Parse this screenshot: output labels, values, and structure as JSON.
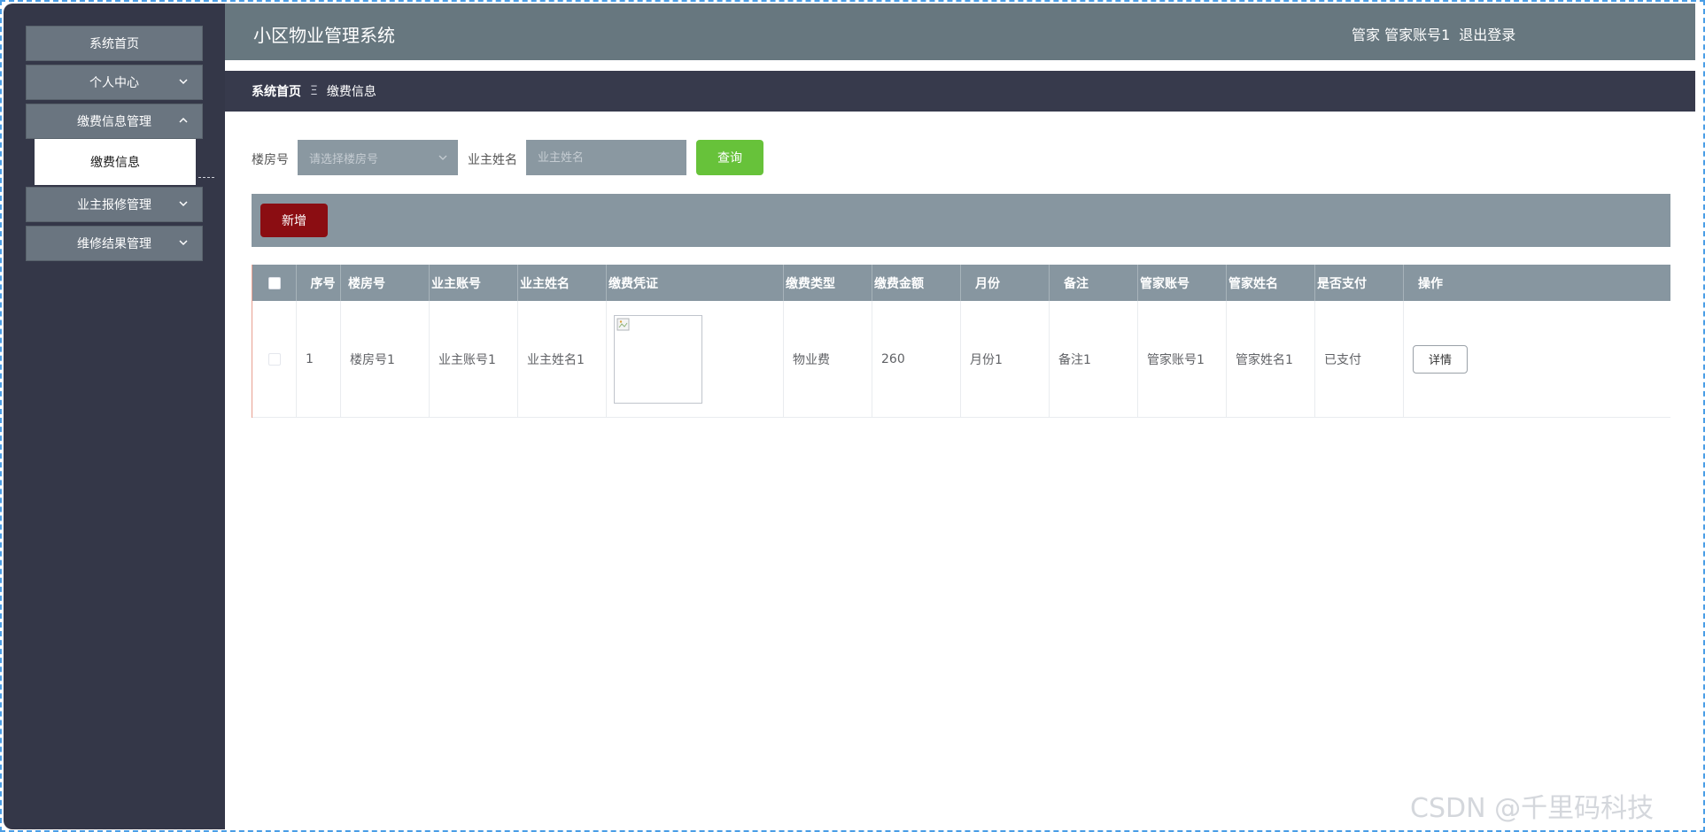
{
  "app": {
    "title": "小区物业管理系统",
    "role": "管家",
    "account": "管家账号1",
    "logout": "退出登录"
  },
  "sidebar": {
    "items": [
      {
        "label": "系统首页"
      },
      {
        "label": "个人中心"
      },
      {
        "label": "缴费信息管理"
      },
      {
        "label": "业主报修管理"
      },
      {
        "label": "维修结果管理"
      }
    ],
    "submenu": {
      "label": "缴费信息"
    }
  },
  "breadcrumb": {
    "home": "系统首页",
    "separator": "Ξ",
    "current": "缴费信息"
  },
  "filters": {
    "building_label": "楼房号",
    "building_placeholder": "请选择楼房号",
    "owner_label": "业主姓名",
    "owner_placeholder": "业主姓名",
    "query_button": "查询"
  },
  "actions": {
    "add_button": "新增"
  },
  "table": {
    "columns": [
      "序号",
      "楼房号",
      "业主账号",
      "业主姓名",
      "缴费凭证",
      "缴费类型",
      "缴费金额",
      "月份",
      "备注",
      "管家账号",
      "管家姓名",
      "是否支付",
      "操作"
    ],
    "rows": [
      {
        "index": "1",
        "building": "楼房号1",
        "owner_account": "业主账号1",
        "owner_name": "业主姓名1",
        "fee_type": "物业费",
        "amount": "260",
        "month": "月份1",
        "remark": "备注1",
        "butler_account": "管家账号1",
        "butler_name": "管家姓名1",
        "paid": "已支付",
        "detail_button": "详情"
      }
    ]
  },
  "watermark": "CSDN @千里码科技",
  "colors": {
    "sidebar_bg": "#343748",
    "topbar_bg": "#67777f",
    "breadcrumb_bg": "#373a4c",
    "query_button": "#67c23a",
    "add_button": "#8b0d12",
    "table_header": "#8796a0"
  }
}
